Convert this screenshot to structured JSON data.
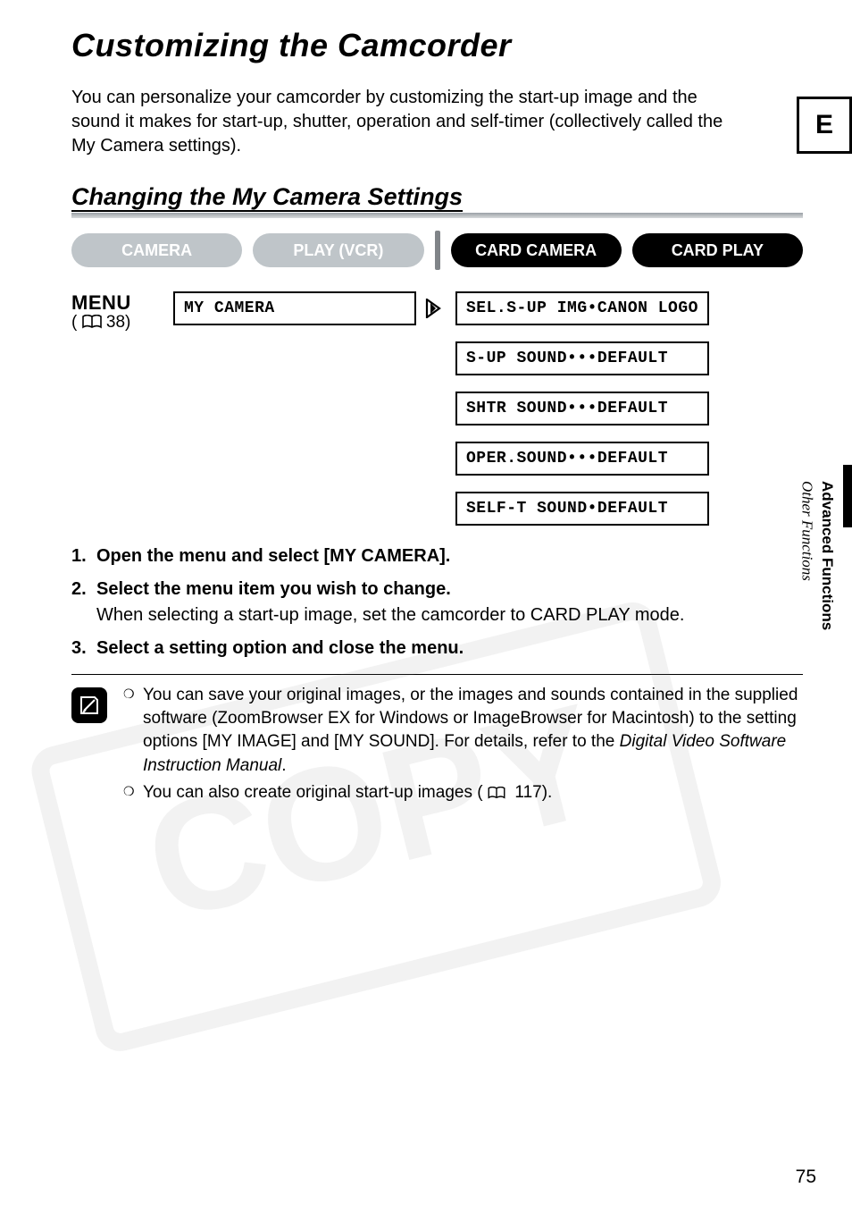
{
  "title": "Customizing the Camcorder",
  "intro": "You can personalize your camcorder by customizing the start-up image and the sound it makes for start-up, shutter, operation and self-timer (collectively called the My Camera settings).",
  "section_tab": "E",
  "side": {
    "bold": "Advanced Functions",
    "italic": "Other Functions"
  },
  "section_title": "Changing the My Camera Settings",
  "modes": {
    "camera": "CAMERA",
    "play_vcr": "PLAY (VCR)",
    "card_camera": "CARD CAMERA",
    "card_play": "CARD PLAY"
  },
  "menu": {
    "label": "MENU",
    "ref_num": "38"
  },
  "osd": {
    "my_camera": "MY CAMERA",
    "items": [
      "SEL.S-UP IMG•CANON LOGO",
      "S-UP SOUND•••DEFAULT",
      "SHTR SOUND•••DEFAULT",
      "OPER.SOUND•••DEFAULT",
      "SELF-T SOUND•DEFAULT"
    ]
  },
  "steps": [
    {
      "main": "Open the menu and select [MY CAMERA]."
    },
    {
      "main": "Select the menu item you wish to change.",
      "sub": "When selecting a start-up image, set the camcorder to CARD PLAY mode."
    },
    {
      "main": "Select a setting option and close the menu."
    }
  ],
  "notes": {
    "n1a": "You can save your original images, or the images and sounds contained in the supplied software (ZoomBrowser EX for Windows or ImageBrowser for Macintosh) to the setting options [MY IMAGE] and [MY SOUND]. For details, refer to the ",
    "n1b_ital": "Digital Video Software Instruction Manual",
    "n1c": ".",
    "n2a": "You can also create original start-up images (",
    "n2_ref": "117",
    "n2b": ")."
  },
  "page_number": "75"
}
